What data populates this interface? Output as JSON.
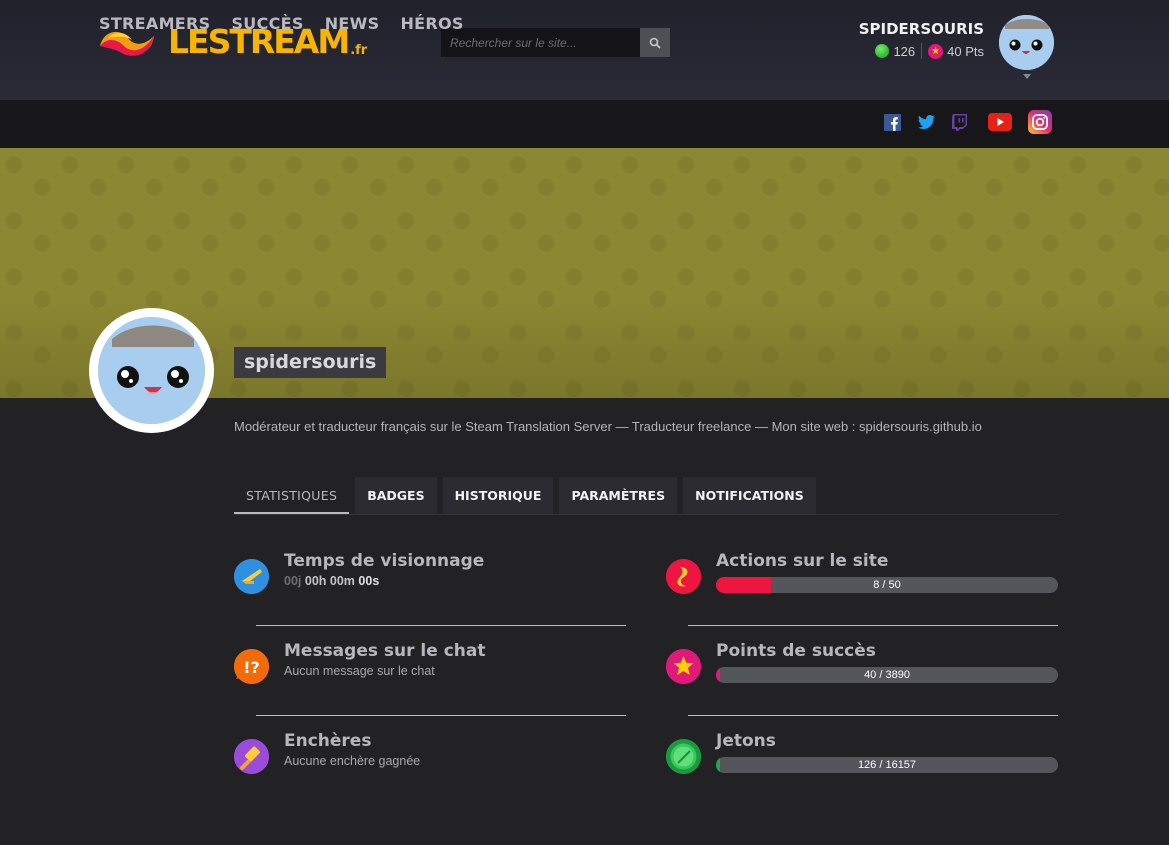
{
  "header": {
    "logo_text": "LESTREAM",
    "logo_tld": ".fr",
    "search_placeholder": "Rechercher sur le site...",
    "user": {
      "name": "SPIDERSOURIS",
      "coins": "126",
      "points": "40 Pts"
    }
  },
  "nav": {
    "items": [
      {
        "label": "STREAMERS"
      },
      {
        "label": "SUCCÈS"
      },
      {
        "label": "NEWS"
      },
      {
        "label": "HÉROS"
      }
    ],
    "socials": [
      "facebook-icon",
      "twitter-icon",
      "twitch-icon",
      "youtube-icon",
      "instagram-icon"
    ]
  },
  "profile": {
    "username": "spidersouris",
    "bio": "Modérateur et traducteur français sur le Steam Translation Server — Traducteur freelance — Mon site web : spidersouris.github.io"
  },
  "tabs": [
    {
      "label": "STATISTIQUES",
      "active": true
    },
    {
      "label": "BADGES"
    },
    {
      "label": "HISTORIQUE"
    },
    {
      "label": "PARAMÈTRES"
    },
    {
      "label": "NOTIFICATIONS"
    }
  ],
  "stats": {
    "watch_time": {
      "title": "Temps de visionnage",
      "days": "00j",
      "hours": "00h",
      "minutes": "00m",
      "seconds": "00s"
    },
    "chat": {
      "title": "Messages sur le chat",
      "sub": "Aucun message sur le chat"
    },
    "auctions": {
      "title": "Enchères",
      "sub": "Aucune enchère gagnée"
    },
    "actions": {
      "title": "Actions sur le site",
      "value": 8,
      "max": 50,
      "text": "8 / 50"
    },
    "achievement_points": {
      "title": "Points de succès",
      "value": 40,
      "max": 3890,
      "text": "40 / 3890"
    },
    "tokens": {
      "title": "Jetons",
      "value": 126,
      "max": 16157,
      "text": "126 / 16157"
    }
  },
  "colors": {
    "accent_yellow": "#f7b500",
    "banner": "#8c8732",
    "bar_red": "#ee1540",
    "bar_pink": "#e0197a",
    "bar_green": "#1ea84a"
  }
}
